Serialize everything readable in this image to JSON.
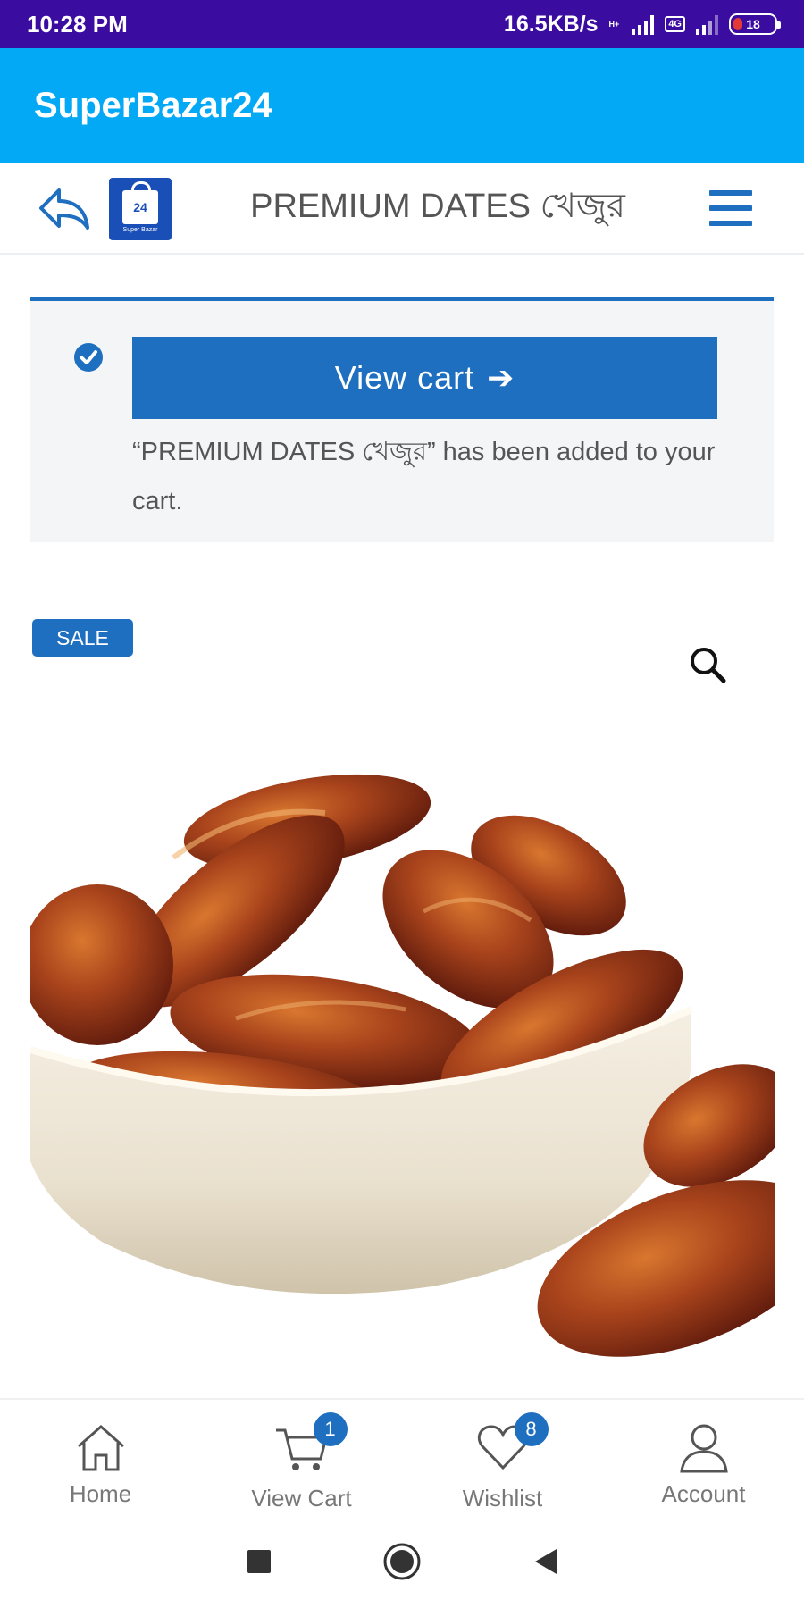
{
  "status_bar": {
    "time": "10:28 PM",
    "speed": "16.5KB/s",
    "net_type": "H+",
    "volte": "4G",
    "battery": "18"
  },
  "app_bar": {
    "title": "SuperBazar24"
  },
  "header": {
    "title": "PREMIUM DATES খেজুর",
    "logo_number": "24",
    "logo_text": "Super Bazar"
  },
  "notice": {
    "button_label": "View cart",
    "button_arrow": "➔",
    "message": "“PREMIUM DATES খেজুর” has been added to your cart."
  },
  "product": {
    "badge": "SALE"
  },
  "bottom_nav": {
    "items": [
      {
        "label": "Home",
        "icon": "home-icon"
      },
      {
        "label": "View Cart",
        "icon": "cart-icon",
        "badge": "1"
      },
      {
        "label": "Wishlist",
        "icon": "heart-icon",
        "badge": "8"
      },
      {
        "label": "Account",
        "icon": "user-icon"
      }
    ]
  },
  "colors": {
    "status_bar": "#3a0ca0",
    "app_bar": "#03a9f4",
    "accent": "#1e6fc0"
  }
}
